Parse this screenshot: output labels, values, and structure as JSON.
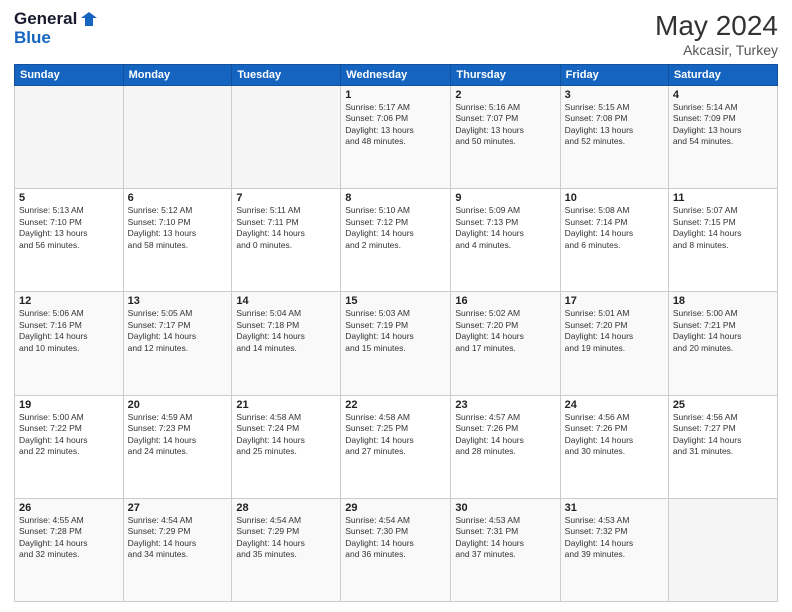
{
  "header": {
    "logo_line1": "General",
    "logo_line2": "Blue",
    "month": "May 2024",
    "location": "Akcasir, Turkey"
  },
  "weekdays": [
    "Sunday",
    "Monday",
    "Tuesday",
    "Wednesday",
    "Thursday",
    "Friday",
    "Saturday"
  ],
  "weeks": [
    [
      {
        "day": "",
        "content": ""
      },
      {
        "day": "",
        "content": ""
      },
      {
        "day": "",
        "content": ""
      },
      {
        "day": "1",
        "content": "Sunrise: 5:17 AM\nSunset: 7:06 PM\nDaylight: 13 hours\nand 48 minutes."
      },
      {
        "day": "2",
        "content": "Sunrise: 5:16 AM\nSunset: 7:07 PM\nDaylight: 13 hours\nand 50 minutes."
      },
      {
        "day": "3",
        "content": "Sunrise: 5:15 AM\nSunset: 7:08 PM\nDaylight: 13 hours\nand 52 minutes."
      },
      {
        "day": "4",
        "content": "Sunrise: 5:14 AM\nSunset: 7:09 PM\nDaylight: 13 hours\nand 54 minutes."
      }
    ],
    [
      {
        "day": "5",
        "content": "Sunrise: 5:13 AM\nSunset: 7:10 PM\nDaylight: 13 hours\nand 56 minutes."
      },
      {
        "day": "6",
        "content": "Sunrise: 5:12 AM\nSunset: 7:10 PM\nDaylight: 13 hours\nand 58 minutes."
      },
      {
        "day": "7",
        "content": "Sunrise: 5:11 AM\nSunset: 7:11 PM\nDaylight: 14 hours\nand 0 minutes."
      },
      {
        "day": "8",
        "content": "Sunrise: 5:10 AM\nSunset: 7:12 PM\nDaylight: 14 hours\nand 2 minutes."
      },
      {
        "day": "9",
        "content": "Sunrise: 5:09 AM\nSunset: 7:13 PM\nDaylight: 14 hours\nand 4 minutes."
      },
      {
        "day": "10",
        "content": "Sunrise: 5:08 AM\nSunset: 7:14 PM\nDaylight: 14 hours\nand 6 minutes."
      },
      {
        "day": "11",
        "content": "Sunrise: 5:07 AM\nSunset: 7:15 PM\nDaylight: 14 hours\nand 8 minutes."
      }
    ],
    [
      {
        "day": "12",
        "content": "Sunrise: 5:06 AM\nSunset: 7:16 PM\nDaylight: 14 hours\nand 10 minutes."
      },
      {
        "day": "13",
        "content": "Sunrise: 5:05 AM\nSunset: 7:17 PM\nDaylight: 14 hours\nand 12 minutes."
      },
      {
        "day": "14",
        "content": "Sunrise: 5:04 AM\nSunset: 7:18 PM\nDaylight: 14 hours\nand 14 minutes."
      },
      {
        "day": "15",
        "content": "Sunrise: 5:03 AM\nSunset: 7:19 PM\nDaylight: 14 hours\nand 15 minutes."
      },
      {
        "day": "16",
        "content": "Sunrise: 5:02 AM\nSunset: 7:20 PM\nDaylight: 14 hours\nand 17 minutes."
      },
      {
        "day": "17",
        "content": "Sunrise: 5:01 AM\nSunset: 7:20 PM\nDaylight: 14 hours\nand 19 minutes."
      },
      {
        "day": "18",
        "content": "Sunrise: 5:00 AM\nSunset: 7:21 PM\nDaylight: 14 hours\nand 20 minutes."
      }
    ],
    [
      {
        "day": "19",
        "content": "Sunrise: 5:00 AM\nSunset: 7:22 PM\nDaylight: 14 hours\nand 22 minutes."
      },
      {
        "day": "20",
        "content": "Sunrise: 4:59 AM\nSunset: 7:23 PM\nDaylight: 14 hours\nand 24 minutes."
      },
      {
        "day": "21",
        "content": "Sunrise: 4:58 AM\nSunset: 7:24 PM\nDaylight: 14 hours\nand 25 minutes."
      },
      {
        "day": "22",
        "content": "Sunrise: 4:58 AM\nSunset: 7:25 PM\nDaylight: 14 hours\nand 27 minutes."
      },
      {
        "day": "23",
        "content": "Sunrise: 4:57 AM\nSunset: 7:26 PM\nDaylight: 14 hours\nand 28 minutes."
      },
      {
        "day": "24",
        "content": "Sunrise: 4:56 AM\nSunset: 7:26 PM\nDaylight: 14 hours\nand 30 minutes."
      },
      {
        "day": "25",
        "content": "Sunrise: 4:56 AM\nSunset: 7:27 PM\nDaylight: 14 hours\nand 31 minutes."
      }
    ],
    [
      {
        "day": "26",
        "content": "Sunrise: 4:55 AM\nSunset: 7:28 PM\nDaylight: 14 hours\nand 32 minutes."
      },
      {
        "day": "27",
        "content": "Sunrise: 4:54 AM\nSunset: 7:29 PM\nDaylight: 14 hours\nand 34 minutes."
      },
      {
        "day": "28",
        "content": "Sunrise: 4:54 AM\nSunset: 7:29 PM\nDaylight: 14 hours\nand 35 minutes."
      },
      {
        "day": "29",
        "content": "Sunrise: 4:54 AM\nSunset: 7:30 PM\nDaylight: 14 hours\nand 36 minutes."
      },
      {
        "day": "30",
        "content": "Sunrise: 4:53 AM\nSunset: 7:31 PM\nDaylight: 14 hours\nand 37 minutes."
      },
      {
        "day": "31",
        "content": "Sunrise: 4:53 AM\nSunset: 7:32 PM\nDaylight: 14 hours\nand 39 minutes."
      },
      {
        "day": "",
        "content": ""
      }
    ]
  ]
}
